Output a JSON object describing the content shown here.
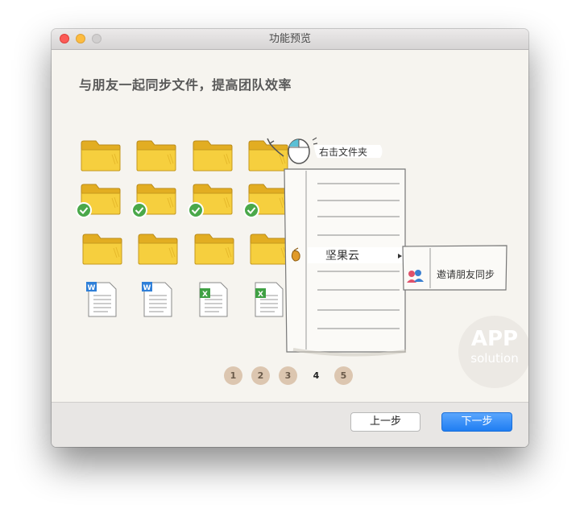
{
  "window": {
    "title": "功能预览"
  },
  "main": {
    "heading": "与朋友一起同步文件，提高团队效率",
    "illustration": {
      "right_click_label": "右击文件夹",
      "menu_item": "坚果云",
      "submenu_item": "邀请朋友同步",
      "doc_word_badge": "W",
      "doc_excel_badge": "X"
    },
    "pager": {
      "pages": [
        "1",
        "2",
        "3",
        "4",
        "5"
      ],
      "current": "4"
    },
    "watermark": {
      "line1": "APP",
      "line2": "solution"
    }
  },
  "footer": {
    "prev_label": "上一步",
    "next_label": "下一步"
  },
  "colors": {
    "folder": "#f3c73a",
    "check": "#4aa84a",
    "primary_button": "#2a85f5",
    "pager_dot": "#dcc6b0"
  }
}
